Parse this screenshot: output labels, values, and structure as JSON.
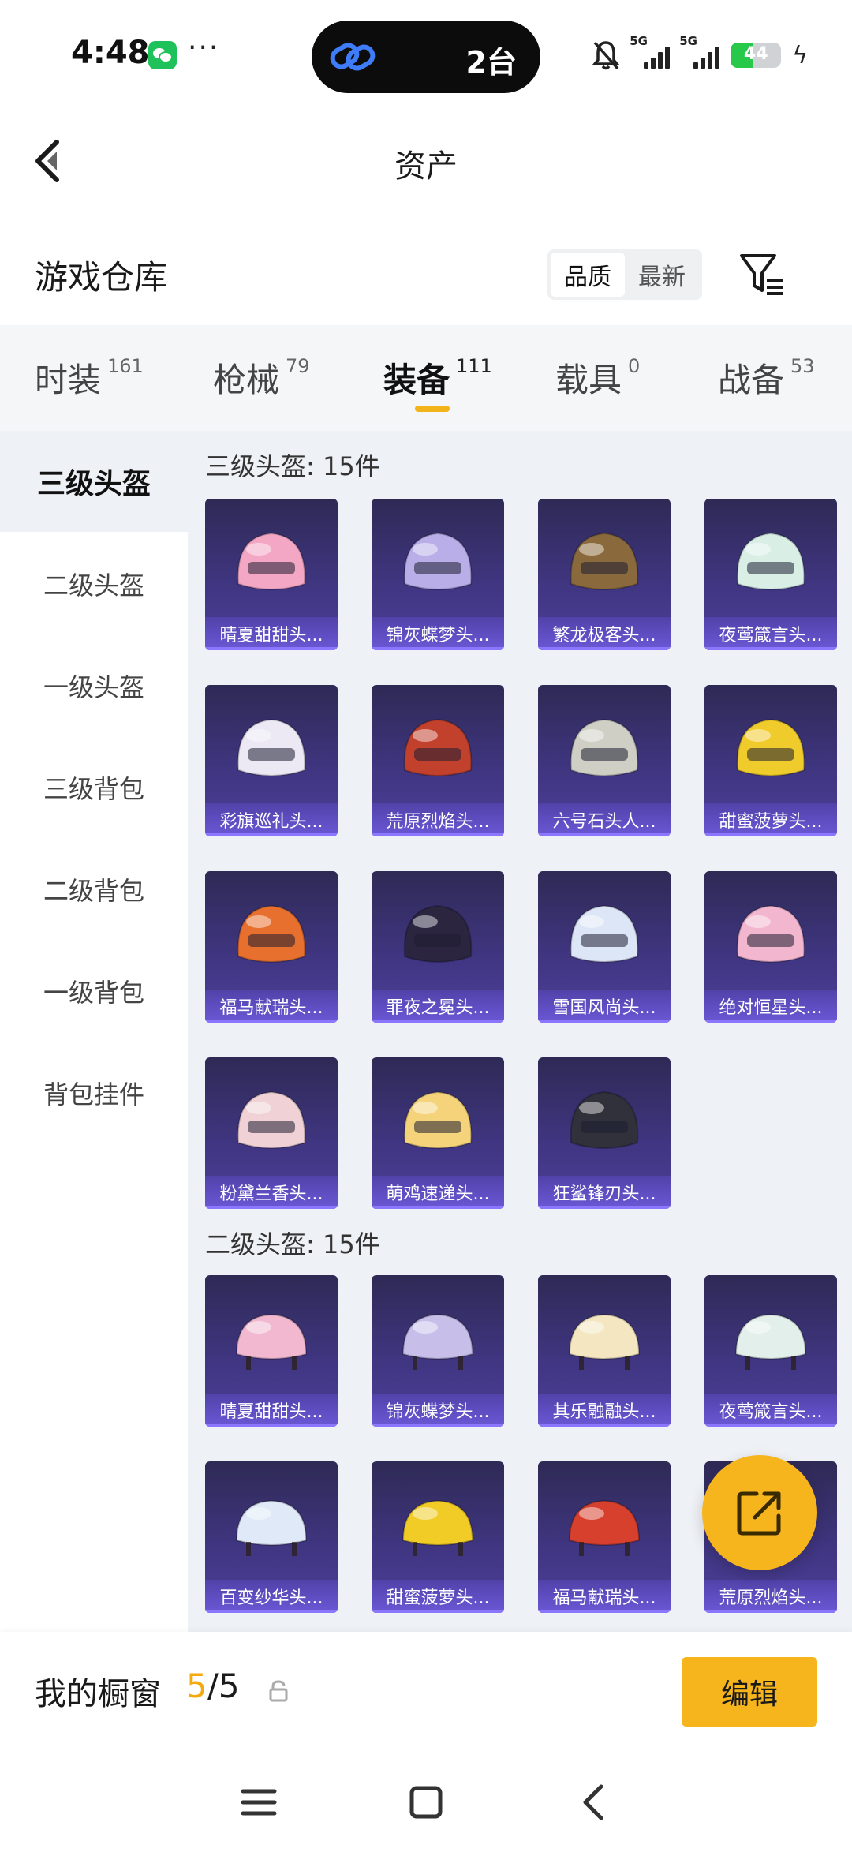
{
  "status_bar": {
    "time": "4:48",
    "more": "···",
    "island_count": "2台",
    "signal_1_label": "5G",
    "signal_2_label": "5G",
    "battery_level": "44"
  },
  "header": {
    "title": "资产"
  },
  "warehouse": {
    "title": "游戏仓库",
    "sort_options": [
      "品质",
      "最新"
    ],
    "sort_selected": "品质"
  },
  "tabs": [
    {
      "label": "时装",
      "count": "161"
    },
    {
      "label": "枪械",
      "count": "79"
    },
    {
      "label": "装备",
      "count": "111"
    },
    {
      "label": "载具",
      "count": "0"
    },
    {
      "label": "战备",
      "count": "53"
    }
  ],
  "active_tab": "装备",
  "sidebar": {
    "items": [
      {
        "label": "三级头盔"
      },
      {
        "label": "二级头盔"
      },
      {
        "label": "一级头盔"
      },
      {
        "label": "三级背包"
      },
      {
        "label": "二级背包"
      },
      {
        "label": "一级背包"
      },
      {
        "label": "背包挂件"
      }
    ],
    "active": "三级头盔"
  },
  "sections": [
    {
      "title": "三级头盔: 15件",
      "items": [
        {
          "name": "晴夏甜甜头...",
          "icon": "pink-helmet",
          "color": "#f3a7c4"
        },
        {
          "name": "锦灰蝶梦头...",
          "icon": "lilac-helmet",
          "color": "#b9aee8"
        },
        {
          "name": "繁龙极客头...",
          "icon": "gold-dragon-helmet",
          "color": "#8a6a3c"
        },
        {
          "name": "夜莺箴言头...",
          "icon": "white-bird-helmet",
          "color": "#d9efe6"
        },
        {
          "name": "彩旗巡礼头...",
          "icon": "white-flag-helmet",
          "color": "#ece8f4"
        },
        {
          "name": "荒原烈焰头...",
          "icon": "red-flame-helmet",
          "color": "#c2412d"
        },
        {
          "name": "六号石头人...",
          "icon": "stone-helmet",
          "color": "#cfcfc6"
        },
        {
          "name": "甜蜜菠萝头...",
          "icon": "pineapple-helmet",
          "color": "#f0cb2c"
        },
        {
          "name": "福马献瑞头...",
          "icon": "horse-helmet",
          "color": "#e8702e"
        },
        {
          "name": "罪夜之冕头...",
          "icon": "dark-wing-helmet",
          "color": "#2b2540"
        },
        {
          "name": "雪国风尚头...",
          "icon": "snow-helmet",
          "color": "#dde6f6"
        },
        {
          "name": "绝对恒星头...",
          "icon": "star-helmet",
          "color": "#f3b6cf"
        },
        {
          "name": "粉黛兰香头...",
          "icon": "rose-helmet",
          "color": "#f0d2d6"
        },
        {
          "name": "萌鸡速递头...",
          "icon": "chick-helmet",
          "color": "#f5d37a"
        },
        {
          "name": "狂鲨锋刃头...",
          "icon": "shark-helmet",
          "color": "#30313a"
        }
      ]
    },
    {
      "title": "二级头盔: 15件",
      "items": [
        {
          "name": "晴夏甜甜头...",
          "icon": "pink-cap",
          "color": "#f1b8cf"
        },
        {
          "name": "锦灰蝶梦头...",
          "icon": "lilac-cap",
          "color": "#c7bfe9"
        },
        {
          "name": "其乐融融头...",
          "icon": "cream-cap",
          "color": "#f3e6c0"
        },
        {
          "name": "夜莺箴言头...",
          "icon": "white-bird-cap",
          "color": "#e3efea"
        },
        {
          "name": "百变纱华头...",
          "icon": "frost-cap",
          "color": "#dfe9f7"
        },
        {
          "name": "甜蜜菠萝头...",
          "icon": "pineapple-cap",
          "color": "#f1cc27"
        },
        {
          "name": "福马献瑞头...",
          "icon": "horse-cap",
          "color": "#d8402e"
        },
        {
          "name": "荒原烈焰头...",
          "icon": "red-flame-cap",
          "color": "#c2412d"
        }
      ]
    }
  ],
  "showcase": {
    "title": "我的橱窗",
    "current": "5",
    "total": "/5",
    "edit_label": "编辑"
  },
  "colors": {
    "accent": "#f6b41d",
    "card_top": "#2e2a55",
    "card_bottom": "#4c3f9a",
    "panel": "#eef1f5"
  }
}
